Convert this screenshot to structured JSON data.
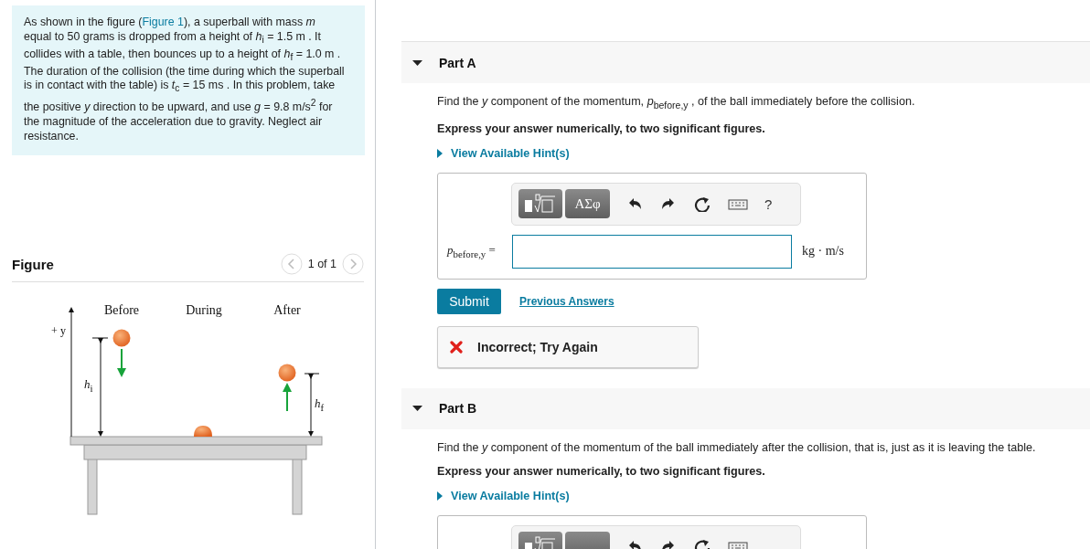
{
  "problem": {
    "before": "As shown in the figure (",
    "link": "Figure 1",
    "after": "), a superball with mass *m* equal to 50 grams is dropped from a height of *h*$_{i}$ = 1.5 m . It collides with a table, then bounces up to a height of *h*$_{f}$ = 1.0 m . The duration of the collision (the time during which the superball is in contact with the table) is *t*$_{c}$ = 15 ms . In this problem, take the positive *y* direction to be upward, and use *g* = 9.8 m/s$^{2}$ for the magnitude of the acceleration due to gravity. Neglect air resistance."
  },
  "figure": {
    "title": "Figure",
    "pager": "1 of 1",
    "axis_label": "+ y",
    "stages": [
      "Before",
      "During",
      "After"
    ],
    "initial_height": "*h*$_{i}$",
    "final_height": "*h*$_{f}$"
  },
  "parts": [
    {
      "title": "Part A",
      "expanded": true,
      "prompt": "Find the *y* component of the momentum, *p*$_{before,y}$ , of the ball immediately before the collision.",
      "instruction": "Express your answer numerically, to two significant figures.",
      "hint": {
        "label": "View Available Hint(s)",
        "expanded": false
      },
      "answer": {
        "symbol_button": "ΑΣφ",
        "help_button": "?",
        "label": "*p*$_{before,y}$  =",
        "unit": "kg · m/s"
      },
      "submit": "Submit",
      "previous": "Previous Answers",
      "feedback": {
        "kind": "incorrect",
        "text": "Incorrect; Try Again"
      }
    },
    {
      "title": "Part B",
      "expanded": true,
      "prompt": "Find the *y* component of the momentum of the ball immediately after the collision, that is, just as it is leaving the table.",
      "instruction": "Express your answer numerically, to two significant figures.",
      "hint": {
        "label": "View Available Hint(s)",
        "expanded": false
      }
    }
  ]
}
